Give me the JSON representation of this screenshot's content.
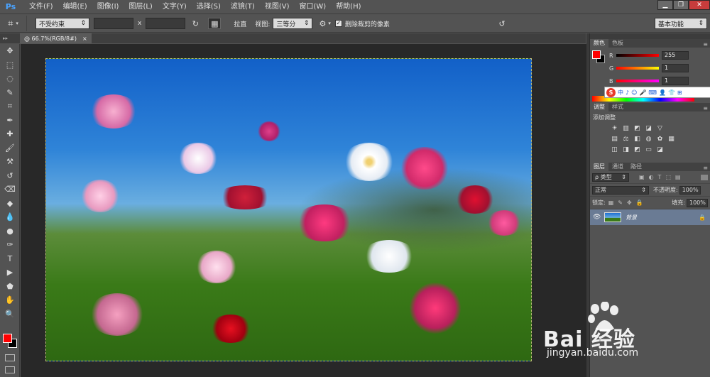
{
  "app": {
    "logo": "Ps"
  },
  "menu": [
    "文件(F)",
    "编辑(E)",
    "图像(I)",
    "图层(L)",
    "文字(Y)",
    "选择(S)",
    "滤镜(T)",
    "视图(V)",
    "窗口(W)",
    "帮助(H)"
  ],
  "window_buttons": {
    "minimize": "▁",
    "restore": "❐",
    "close": "✕"
  },
  "options": {
    "tool_icon": "crop-icon",
    "ratio_select": "不受约束",
    "times_sign": "x",
    "straighten_label": "拉直",
    "view_label": "视图:",
    "view_select": "三等分",
    "delete_cropped_label": "删除裁剪的像素",
    "delete_cropped_checked": true,
    "workspace_select": "基本功能"
  },
  "document_tab": {
    "title": "@ 66.7%(RGB/8#)",
    "close": "×"
  },
  "tools": [
    "move-icon",
    "marquee-icon",
    "lasso-icon",
    "quick-select-icon",
    "crop-icon",
    "eyedropper-icon",
    "healing-icon",
    "brush-icon",
    "stamp-icon",
    "history-brush-icon",
    "eraser-icon",
    "paint-bucket-icon",
    "blur-icon",
    "dodge-icon",
    "pen-icon",
    "type-icon",
    "path-select-icon",
    "shape-icon",
    "hand-icon",
    "zoom-icon"
  ],
  "tool_glyphs": [
    "✥",
    "⬚",
    "◌",
    "✎",
    "⌗",
    "✒",
    "✚",
    "🖌",
    "⚒",
    "↺",
    "⌫",
    "◆",
    "💧",
    "●",
    "✑",
    "T",
    "▶",
    "⬟",
    "✋",
    "🔍"
  ],
  "colors": {
    "foreground": "#ff0000",
    "background": "#000000"
  },
  "color_panel": {
    "tabs": [
      "颜色",
      "色板"
    ],
    "sliders": [
      {
        "label": "R",
        "value": "255"
      },
      {
        "label": "G",
        "value": "1"
      },
      {
        "label": "B",
        "value": "1"
      }
    ]
  },
  "ime": {
    "logo": "S",
    "items": [
      "中",
      "♪",
      "☺",
      "🎤",
      "⌨",
      "👤",
      "👕",
      "⊞"
    ]
  },
  "adjustments_panel": {
    "tabs": [
      "调整",
      "样式"
    ],
    "title": "添加调整"
  },
  "layers_panel": {
    "tabs": [
      "图层",
      "通道",
      "路径"
    ],
    "filter_select": "ρ 类型",
    "blend_select": "正常",
    "opacity_label": "不透明度:",
    "opacity_value": "100%",
    "lock_label": "锁定:",
    "fill_label": "填充:",
    "fill_value": "100%",
    "layers": [
      {
        "name": "背景",
        "visible": true,
        "locked": true
      }
    ]
  },
  "watermark": {
    "brand": "Bai  经验",
    "url": "jingyan.baidu.com"
  }
}
